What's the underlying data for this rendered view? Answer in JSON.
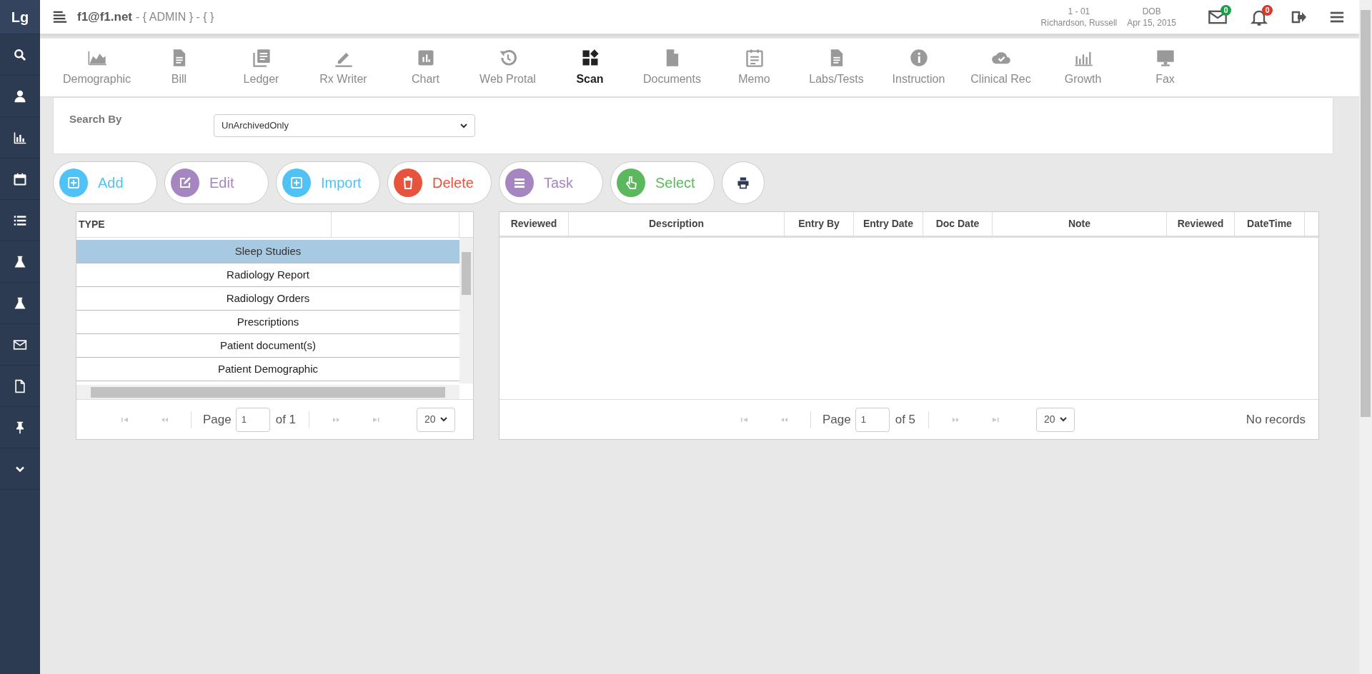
{
  "header": {
    "logo": "Lg",
    "user": "f1@f1.net",
    "context": "- { ADMIN } - { }",
    "patient_id": "1 - 01",
    "patient_name": "Richardson, Russell",
    "dob_label": "DOB",
    "dob": "Apr 15, 2015",
    "mail_count": "0",
    "alert_count": "0"
  },
  "tabs": [
    {
      "label": "Demographic",
      "selected": false
    },
    {
      "label": "Bill",
      "selected": false
    },
    {
      "label": "Ledger",
      "selected": false
    },
    {
      "label": "Rx Writer",
      "selected": false
    },
    {
      "label": "Chart",
      "selected": false
    },
    {
      "label": "Web Protal",
      "selected": false
    },
    {
      "label": "Scan",
      "selected": true
    },
    {
      "label": "Documents",
      "selected": false
    },
    {
      "label": "Memo",
      "selected": false
    },
    {
      "label": "Labs/Tests",
      "selected": false
    },
    {
      "label": "Instruction",
      "selected": false
    },
    {
      "label": "Clinical Rec",
      "selected": false
    },
    {
      "label": "Growth",
      "selected": false
    },
    {
      "label": "Fax",
      "selected": false
    }
  ],
  "search": {
    "label": "Search By",
    "value": "UnArchivedOnly"
  },
  "actions": [
    {
      "label": "Add",
      "color": "#4fc3f7"
    },
    {
      "label": "Edit",
      "color": "#a586c0"
    },
    {
      "label": "Import",
      "color": "#4fc3f7"
    },
    {
      "label": "Delete",
      "color": "#e8533d"
    },
    {
      "label": "Task",
      "color": "#a586c0"
    },
    {
      "label": "Select",
      "color": "#5cb85c"
    }
  ],
  "type_grid": {
    "columns": [
      "TYPE"
    ],
    "rows": [
      {
        "label": "Sleep Studies",
        "selected": true
      },
      {
        "label": "Radiology Report",
        "selected": false
      },
      {
        "label": "Radiology Orders",
        "selected": false
      },
      {
        "label": "Prescriptions",
        "selected": false
      },
      {
        "label": "Patient document(s)",
        "selected": false
      },
      {
        "label": "Patient Demographic",
        "selected": false
      }
    ],
    "pager": {
      "page_label": "Page",
      "page": "1",
      "of": "of 1",
      "page_size": "20"
    }
  },
  "documents_grid": {
    "columns": [
      "Reviewed",
      "Description",
      "Entry By",
      "Entry Date",
      "Doc Date",
      "Note",
      "Reviewed",
      "DateTime"
    ],
    "pager": {
      "page_label": "Page",
      "page": "1",
      "of": "of 5",
      "page_size": "20",
      "status": "No records"
    }
  }
}
